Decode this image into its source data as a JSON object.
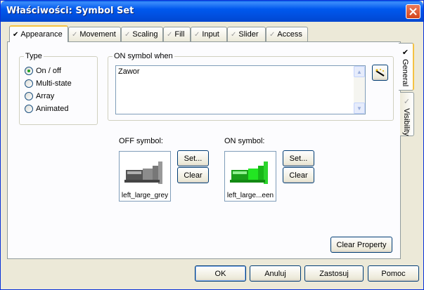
{
  "window": {
    "title": "Właściwości: Symbol Set"
  },
  "tabs": [
    {
      "label": "Appearance",
      "checked": true
    },
    {
      "label": "Movement",
      "checked": false
    },
    {
      "label": "Scaling",
      "checked": false
    },
    {
      "label": "Fill",
      "checked": false
    },
    {
      "label": "Input",
      "checked": false
    },
    {
      "label": "Slider",
      "checked": false
    },
    {
      "label": "Access",
      "checked": false
    }
  ],
  "side_tabs": [
    {
      "label": "General",
      "checked": true
    },
    {
      "label": "Visibility",
      "checked": false
    }
  ],
  "type_group": {
    "legend": "Type",
    "options": [
      {
        "label": "On / off",
        "selected": true
      },
      {
        "label": "Multi-state",
        "selected": false
      },
      {
        "label": "Array",
        "selected": false
      },
      {
        "label": "Animated",
        "selected": false
      }
    ]
  },
  "on_when": {
    "legend": "ON symbol when",
    "value": "Zawor"
  },
  "off_symbol": {
    "label": "OFF symbol:",
    "caption": "left_large_grey",
    "set": "Set...",
    "clear": "Clear",
    "color": "#8c8c8c"
  },
  "on_symbol": {
    "label": "ON symbol:",
    "caption": "left_large...een",
    "set": "Set...",
    "clear": "Clear",
    "color": "#22e622"
  },
  "clear_property": "Clear Property",
  "footer": {
    "ok": "OK",
    "cancel": "Anuluj",
    "apply": "Zastosuj",
    "help": "Pomoc"
  },
  "colors": {
    "title_bar": "#0058ee",
    "close": "#d4451c",
    "tab_highlight": "#f5c242"
  }
}
